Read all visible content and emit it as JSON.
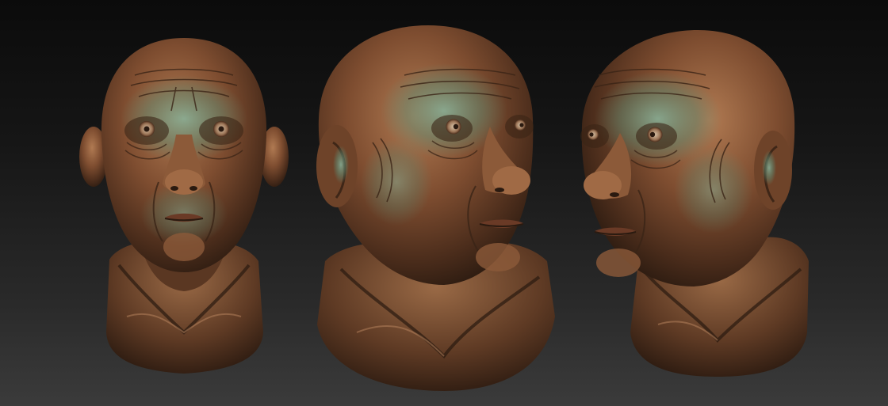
{
  "scene": {
    "views": [
      {
        "id": "front",
        "kind": "front-view"
      },
      {
        "id": "three-quarter-right",
        "kind": "three-quarter-view"
      },
      {
        "id": "three-quarter-left",
        "kind": "three-quarter-view"
      }
    ],
    "colors": {
      "background_top": "#0b0b0b",
      "background_bottom": "#3b3b3b",
      "bronze_dark": "#3a2416",
      "bronze_mid": "#7a4a2e",
      "bronze_light": "#a8714b",
      "patina": "#6f9a84",
      "rim_red": "#8a3a28"
    }
  }
}
